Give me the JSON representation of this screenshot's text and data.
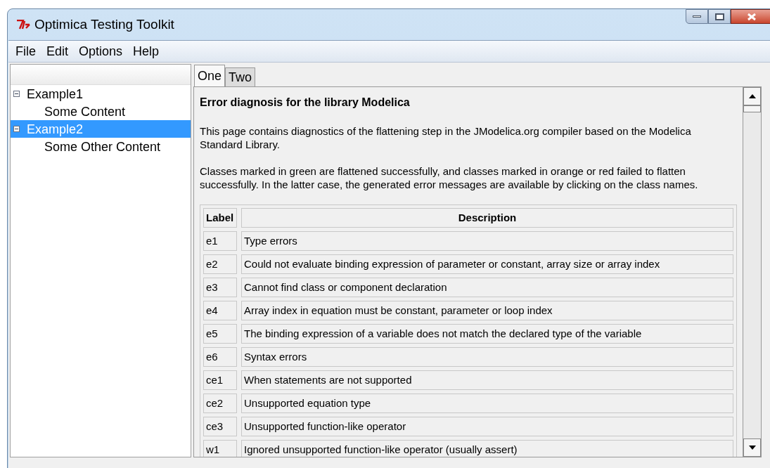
{
  "window": {
    "title": "Optimica Testing Toolkit"
  },
  "menu": [
    "File",
    "Edit",
    "Options",
    "Help"
  ],
  "tree": [
    {
      "label": "Example1",
      "expanded": true,
      "selected": false,
      "children": [
        {
          "label": "Some Content",
          "selected": false
        }
      ]
    },
    {
      "label": "Example2",
      "expanded": true,
      "selected": true,
      "children": [
        {
          "label": "Some Other Content",
          "selected": false
        }
      ]
    }
  ],
  "tabs": [
    {
      "label": "One",
      "selected": true
    },
    {
      "label": "Two",
      "selected": false
    }
  ],
  "page": {
    "heading": "Error diagnosis for the library Modelica",
    "paragraphs": [
      "This page contains diagnostics of the flattening step in the JModelica.org compiler based on the Modelica Standard Library.",
      "Classes marked in green are flattened successfully, and classes marked in orange or red failed to flatten successfully. In the latter case, the generated error messages are available by clicking on the class names."
    ],
    "table": {
      "columns": [
        "Label",
        "Description"
      ],
      "rows": [
        [
          "e1",
          "Type errors"
        ],
        [
          "e2",
          "Could not evaluate binding expression of parameter or constant, array size or array index"
        ],
        [
          "e3",
          "Cannot find class or component declaration"
        ],
        [
          "e4",
          "Array index in equation must be constant, parameter or loop index"
        ],
        [
          "e5",
          "The binding expression of a variable does not match the declared type of the variable"
        ],
        [
          "e6",
          "Syntax errors"
        ],
        [
          "ce1",
          "When statements are not supported"
        ],
        [
          "ce2",
          "Unsupported equation type"
        ],
        [
          "ce3",
          "Unsupported function-like operator"
        ],
        [
          "w1",
          "Ignored unsupported function-like operator (usually assert)"
        ]
      ]
    }
  }
}
